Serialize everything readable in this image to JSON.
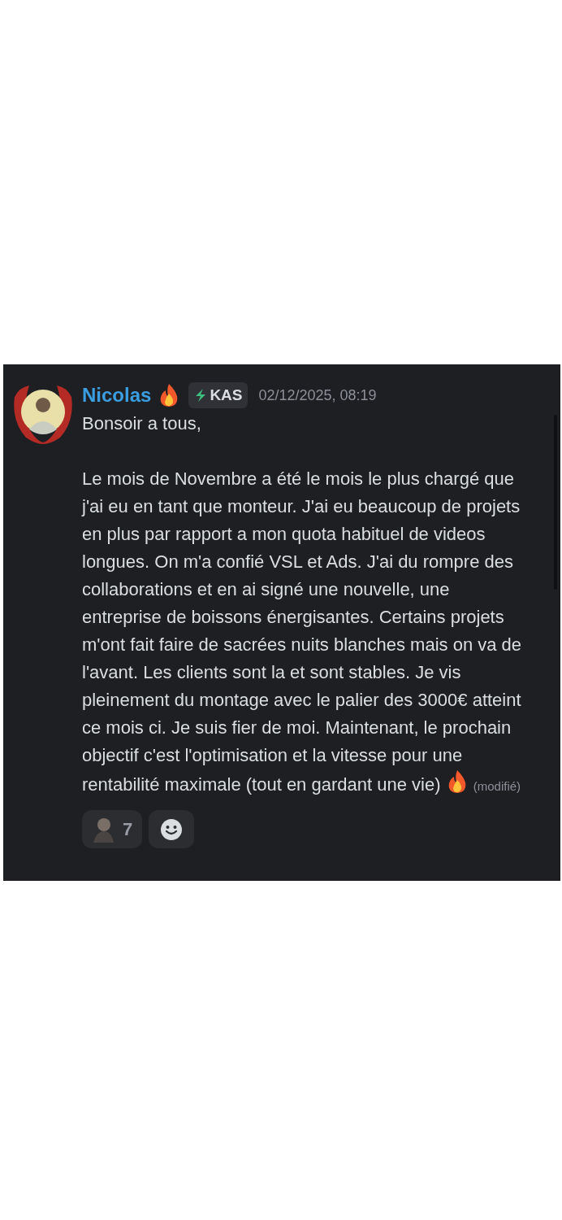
{
  "message": {
    "author": "Nicolas",
    "badge": "KAS",
    "timestamp": "02/12/2025, 08:19",
    "paragraphs": [
      "Bonsoir a tous,",
      "Le mois de Novembre a été le mois le plus chargé que j'ai eu en tant que monteur. J'ai eu beaucoup de projets en plus par rapport a mon quota habituel de videos longues. On m'a confié VSL et Ads. J'ai du rompre des collaborations et en ai signé une nouvelle, une entreprise de boissons énergisantes. Certains projets m'ont fait faire de sacrées nuits blanches mais on va de l'avant. Les clients sont la et sont stables. Je vis pleinement du montage avec le palier des 3000€ atteint ce mois ci. Je suis fier de moi. Maintenant, le prochain objectif c'est l'optimisation et la vitesse pour une rentabilité maximale (tout en gardant une vie)"
    ],
    "edited_label": "(modifié)",
    "reactions": [
      {
        "count": "7"
      }
    ]
  }
}
